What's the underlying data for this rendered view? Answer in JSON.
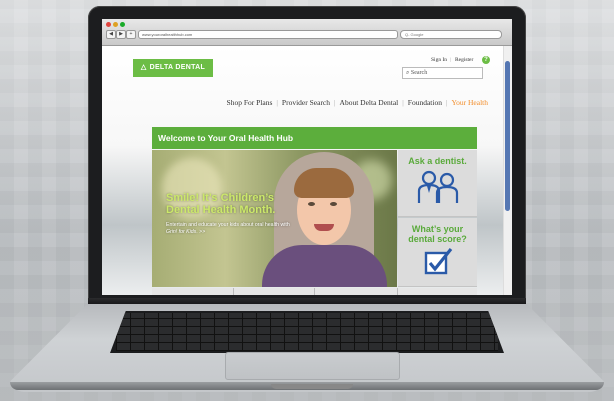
{
  "browser": {
    "url": "www.youroralhealthhub.com",
    "search_placeholder": "Q- Google",
    "nav_back": "◀",
    "nav_forward": "▶",
    "reload": "+"
  },
  "site": {
    "logo_text": "DELTA DENTAL",
    "sign_in": "Sign In",
    "register": "Register",
    "help": "?",
    "search_placeholder": "Search",
    "nav": [
      "Shop For Plans",
      "Provider Search",
      "About Delta Dental",
      "Foundation",
      "Your Health"
    ],
    "nav_active_index": 4,
    "banner_title": "Welcome to Your Oral Health Hub",
    "hero": {
      "headline": "Smile! It’s Children’s Dental Health Month.",
      "sub_before": "Entertain and educate your kids about oral health with ",
      "sub_em": "Grin! for Kids",
      "sub_after": ". >>"
    },
    "cards": [
      {
        "title": "Ask a dentist.",
        "icon": "dentists-icon"
      },
      {
        "title": "What’s your dental score?",
        "icon": "checkbox-icon"
      }
    ]
  },
  "colors": {
    "brand_green": "#6cbd45",
    "banner_green": "#5cae3c",
    "active_nav": "#f28c28",
    "card_title": "#5aaa3b",
    "icon_blue": "#2a5aa8"
  }
}
